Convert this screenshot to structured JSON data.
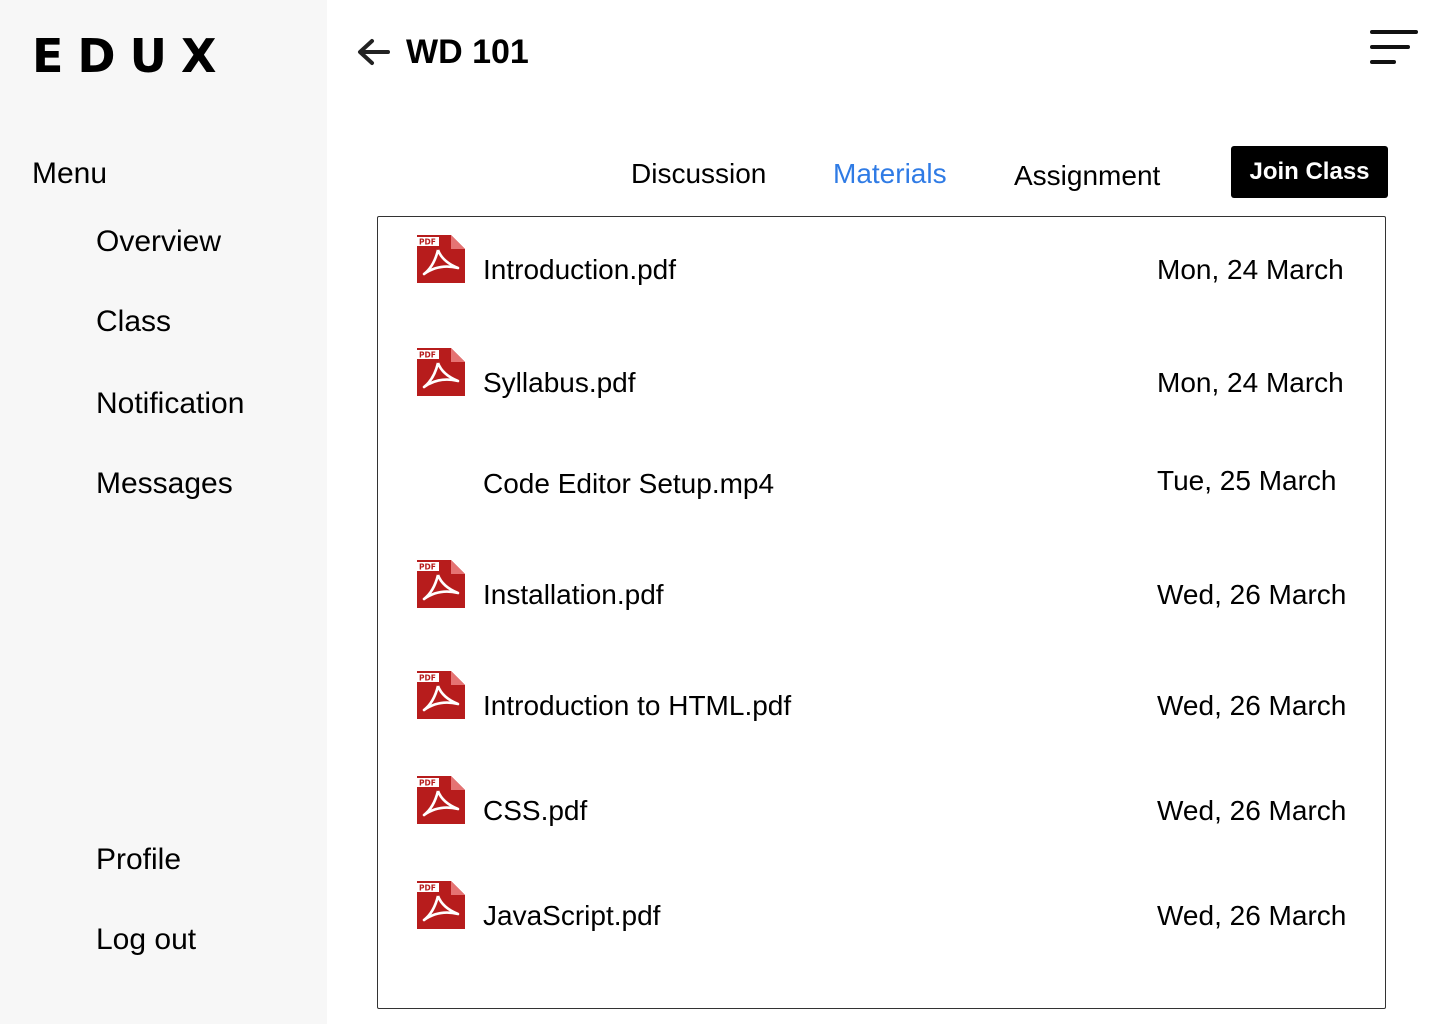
{
  "brand": {
    "logo_text": "EDUX"
  },
  "sidebar": {
    "menu_heading": "Menu",
    "items": [
      {
        "label": "Overview"
      },
      {
        "label": "Class"
      },
      {
        "label": "Notification"
      },
      {
        "label": "Messages"
      }
    ],
    "bottom_items": [
      {
        "label": "Profile"
      },
      {
        "label": "Log out"
      }
    ]
  },
  "header": {
    "back_icon": "arrow-left-icon",
    "title": "WD 101",
    "menu_icon": "hamburger-menu-icon"
  },
  "tabs": [
    {
      "label": "Discussion",
      "active": false
    },
    {
      "label": "Materials",
      "active": true
    },
    {
      "label": "Assignment",
      "active": false
    }
  ],
  "join_button": {
    "label": "Join Class"
  },
  "materials": [
    {
      "name": "Introduction.pdf",
      "date": "Mon, 24 March",
      "icon": "pdf-file-icon"
    },
    {
      "name": "Syllabus.pdf",
      "date": "Mon, 24 March",
      "icon": "pdf-file-icon"
    },
    {
      "name": "Code Editor Setup.mp4",
      "date": "Tue, 25 March",
      "icon": ""
    },
    {
      "name": "Installation.pdf",
      "date": "Wed, 26 March",
      "icon": "pdf-file-icon"
    },
    {
      "name": "Introduction to HTML.pdf",
      "date": "Wed, 26 March",
      "icon": "pdf-file-icon"
    },
    {
      "name": "CSS.pdf",
      "date": "Wed, 26 March",
      "icon": "pdf-file-icon"
    },
    {
      "name": "JavaScript.pdf",
      "date": "Wed, 26 March",
      "icon": "pdf-file-icon"
    }
  ],
  "pdf_icon_badge": "PDF",
  "colors": {
    "accent": "#2f7be5",
    "sidebar_bg": "#f7f7f7",
    "pdf_red": "#b71c1c",
    "button_bg": "#000000"
  }
}
